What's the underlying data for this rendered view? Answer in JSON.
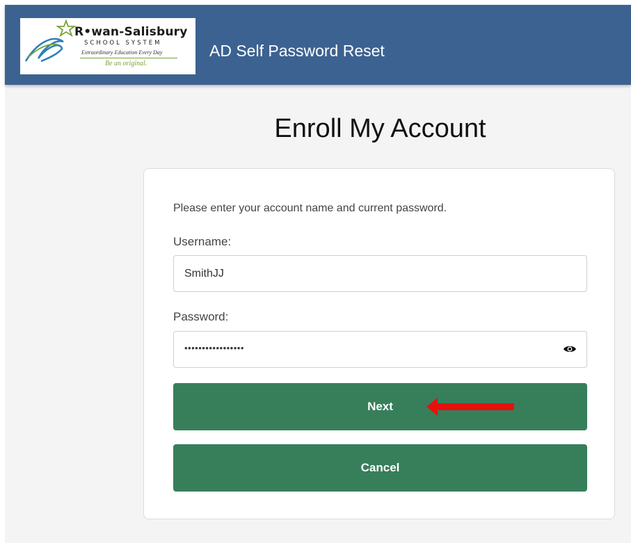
{
  "header": {
    "logo": {
      "name": "R•wan-Salisbury",
      "system": "SCHOOL SYSTEM",
      "tagline": "Extraordinary Education Every Day",
      "motto": "Be an original."
    },
    "app_title": "AD Self Password Reset",
    "background_color": "#3c6291"
  },
  "main": {
    "heading": "Enroll My Account",
    "instruction": "Please enter your account name and current password.",
    "username": {
      "label": "Username:",
      "value": "SmithJJ"
    },
    "password": {
      "label": "Password:",
      "masked_value": "•••••••••••••••••",
      "toggle_icon": "eye-icon"
    },
    "buttons": {
      "next_label": "Next",
      "cancel_label": "Cancel",
      "color": "#377f5b"
    },
    "annotation_arrow_color": "#e8100d"
  }
}
